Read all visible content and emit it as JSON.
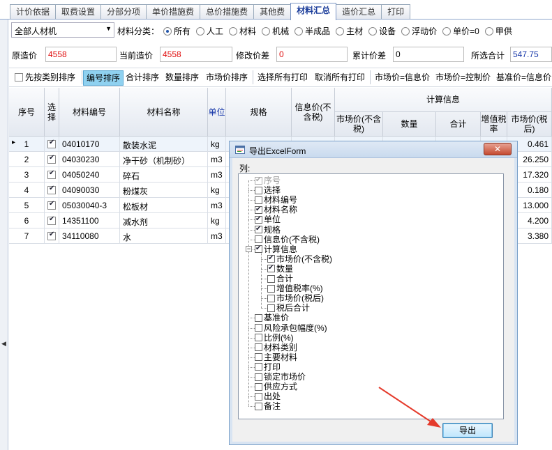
{
  "tabs": [
    {
      "label": "计价依据"
    },
    {
      "label": "取费设置"
    },
    {
      "label": "分部分项"
    },
    {
      "label": "单价措施费"
    },
    {
      "label": "总价措施费"
    },
    {
      "label": "其他费"
    },
    {
      "label": "材料汇总",
      "active": true
    },
    {
      "label": "造价汇总"
    },
    {
      "label": "打印"
    }
  ],
  "filter": {
    "combo_value": "全部人材机",
    "category_label": "材料分类：",
    "options": [
      {
        "label": "所有",
        "selected": true
      },
      {
        "label": "人工"
      },
      {
        "label": "材料"
      },
      {
        "label": "机械"
      },
      {
        "label": "半成品"
      },
      {
        "label": "主材"
      },
      {
        "label": "设备"
      },
      {
        "label": "浮动价"
      },
      {
        "label": "单价=0"
      },
      {
        "label": "甲供"
      }
    ]
  },
  "summary": {
    "orig_label": "原造价",
    "orig_value": "4558",
    "cur_label": "当前造价",
    "cur_value": "4558",
    "diff_label": "修改价差",
    "diff_value": "0",
    "cum_label": "累计价差",
    "cum_value": "0",
    "sel_label": "所选合计",
    "sel_value": "547.75"
  },
  "toolbar": {
    "sort_by_category": "先按类别排序",
    "sort_code": "编号排序",
    "sort_total": "合计排序",
    "sort_qty": "数量排序",
    "sort_price": "市场价排序",
    "select_all_print": "选择所有打印",
    "cancel_all_print": "取消所有打印",
    "market_eq_info": "市场价=信息价",
    "market_eq_ctrl": "市场价=控制价",
    "base_eq_info": "基准价=信息价"
  },
  "grid": {
    "headers": {
      "seq": "序号",
      "select": "选择",
      "code": "材料编号",
      "name": "材料名称",
      "unit": "单位",
      "spec": "规格",
      "info_price": "信息价(不含税)",
      "calc": "计算信息",
      "market_pre": "市场价(不含税)",
      "qty": "数量",
      "total": "合计",
      "vat": "增值税率",
      "market_post": "市场价(税后)"
    },
    "rows": [
      {
        "seq": "1",
        "code": "04010170",
        "name": "散装水泥",
        "unit": "kg",
        "spec": "",
        "market_post": "0.461"
      },
      {
        "seq": "2",
        "code": "04030230",
        "name": "净干砂（机制砂）",
        "unit": "m3",
        "spec": "",
        "market_post": "26.250"
      },
      {
        "seq": "3",
        "code": "04050240",
        "name": "碎石",
        "unit": "m3",
        "spec": "",
        "market_post": "17.320"
      },
      {
        "seq": "4",
        "code": "04090030",
        "name": "粉煤灰",
        "unit": "kg",
        "spec": "",
        "market_post": "0.180"
      },
      {
        "seq": "5",
        "code": "05030040-3",
        "name": "松板材",
        "unit": "m3",
        "spec": "",
        "market_post": "13.000"
      },
      {
        "seq": "6",
        "code": "14351100",
        "name": "减水剂",
        "unit": "kg",
        "spec": "",
        "market_post": "4.200"
      },
      {
        "seq": "7",
        "code": "34110080",
        "name": "水",
        "unit": "m3",
        "spec": "",
        "market_post": "3.380"
      }
    ]
  },
  "dialog": {
    "title": "导出ExcelForm",
    "close_label": "✕",
    "columns_label": "列:",
    "export_label": "导出",
    "items": [
      {
        "label": "序号",
        "checked": true,
        "disabled": true,
        "level": 0
      },
      {
        "label": "选择",
        "checked": false,
        "level": 0
      },
      {
        "label": "材料编号",
        "checked": false,
        "level": 0
      },
      {
        "label": "材料名称",
        "checked": true,
        "level": 0
      },
      {
        "label": "单位",
        "checked": true,
        "level": 0
      },
      {
        "label": "规格",
        "checked": true,
        "level": 0
      },
      {
        "label": "信息价(不含税)",
        "checked": false,
        "level": 0
      },
      {
        "label": "计算信息",
        "checked": true,
        "level": 0,
        "expanded": true
      },
      {
        "label": "市场价(不含税)",
        "checked": true,
        "level": 1
      },
      {
        "label": "数量",
        "checked": true,
        "level": 1
      },
      {
        "label": "合计",
        "checked": false,
        "level": 1
      },
      {
        "label": "增值税率(%)",
        "checked": false,
        "level": 1
      },
      {
        "label": "市场价(税后)",
        "checked": false,
        "level": 1
      },
      {
        "label": "税后合计",
        "checked": false,
        "level": 1
      },
      {
        "label": "基准价",
        "checked": false,
        "level": 0
      },
      {
        "label": "风险承包幅度(%)",
        "checked": false,
        "level": 0
      },
      {
        "label": "比例(%)",
        "checked": false,
        "level": 0
      },
      {
        "label": "材料类别",
        "checked": false,
        "level": 0
      },
      {
        "label": "主要材料",
        "checked": false,
        "level": 0
      },
      {
        "label": "打印",
        "checked": false,
        "level": 0
      },
      {
        "label": "锁定市场价",
        "checked": false,
        "level": 0
      },
      {
        "label": "供应方式",
        "checked": false,
        "level": 0
      },
      {
        "label": "出处",
        "checked": false,
        "level": 0
      },
      {
        "label": "备注",
        "checked": false,
        "level": 0
      }
    ]
  },
  "colors": {
    "accent": "#1a3c9a",
    "highlight": "#8fd1f0",
    "red": "#e01010",
    "arrow": "#e53b2c"
  }
}
